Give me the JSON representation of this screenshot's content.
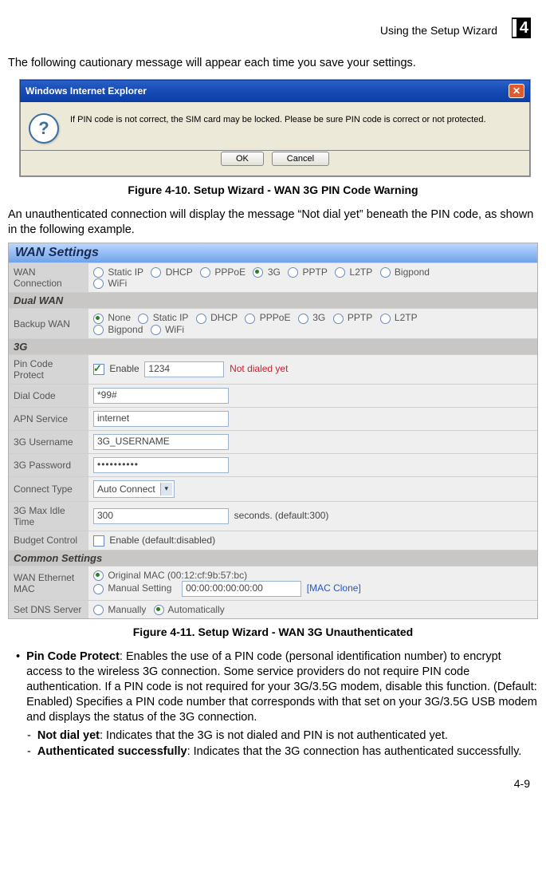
{
  "header": {
    "section_title": "Using the Setup Wizard",
    "chapter_number": "4"
  },
  "intro_para": "The following cautionary message will appear each time you save your settings.",
  "dialog": {
    "title": "Windows Internet Explorer",
    "message": "If PIN code is not correct, the SIM card may be locked. Please be sure PIN code is correct or not protected.",
    "ok": "OK",
    "cancel": "Cancel"
  },
  "fig1_caption": "Figure 4-10.   Setup Wizard - WAN 3G PIN Code Warning",
  "para2": "An unauthenticated connection will display the message “Not dial yet” beneath the PIN code, as shown in the following example.",
  "wan": {
    "title": "WAN Settings",
    "rows": {
      "wan_connection_label": "WAN Connection",
      "wan_opts": {
        "static": "Static IP",
        "dhcp": "DHCP",
        "pppoe": "PPPoE",
        "g3": "3G",
        "pptp": "PPTP",
        "l2tp": "L2TP",
        "bigpond": "Bigpond",
        "wifi": "WiFi"
      },
      "dual_wan": "Dual WAN",
      "backup_label": "Backup WAN",
      "backup_opts": {
        "none": "None",
        "static": "Static IP",
        "dhcp": "DHCP",
        "pppoe": "PPPoE",
        "g3": "3G",
        "pptp": "PPTP",
        "l2tp": "L2TP",
        "bigpond": "Bigpond",
        "wifi": "WiFi"
      },
      "g3_section": "3G",
      "pin_label": "Pin Code Protect",
      "pin_enable": "Enable",
      "pin_value": "1234",
      "pin_status": "Not dialed yet",
      "dial_label": "Dial Code",
      "dial_value": "*99#",
      "apn_label": "APN Service",
      "apn_value": "internet",
      "user_label": "3G Username",
      "user_value": "3G_USERNAME",
      "pass_label": "3G Password",
      "pass_value": "••••••••••",
      "ct_label": "Connect Type",
      "ct_value": "Auto Connect",
      "idle_label": "3G Max Idle Time",
      "idle_value": "300",
      "idle_suffix": "seconds. (default:300)",
      "budget_label": "Budget Control",
      "budget_text": "Enable (default:disabled)",
      "common_section": "Common Settings",
      "mac_label": "WAN Ethernet MAC",
      "mac_orig": "Original MAC (00:12:cf:9b:57:bc)",
      "mac_manual": "Manual Setting",
      "mac_manual_value": "00:00:00:00:00:00",
      "mac_clone": "[MAC Clone]",
      "dns_label": "Set DNS Server",
      "dns_manual": "Manually",
      "dns_auto": "Automatically"
    }
  },
  "fig2_caption": "Figure 4-11.   Setup Wizard - WAN 3G Unauthenticated",
  "bullets": {
    "pin_title": "Pin Code Protect",
    "pin_text": ": Enables the use of a PIN code (personal identification number) to encrypt access to the wireless 3G connection. Some service providers do not require PIN code authentication. If a PIN code is not required for your 3G/3.5G modem, disable this function. (Default: Enabled) Specifies a PIN code number that corresponds with that set on your 3G/3.5G USB modem and displays the status of the 3G connection.",
    "sub1_title": "Not dial yet",
    "sub1_text": ":  Indicates that the 3G is not dialed and PIN is not authenticated yet.",
    "sub2_title": "Authenticated successfully",
    "sub2_text": ":  Indicates that the 3G connection has authenticated successfully."
  },
  "footer": "4-9"
}
